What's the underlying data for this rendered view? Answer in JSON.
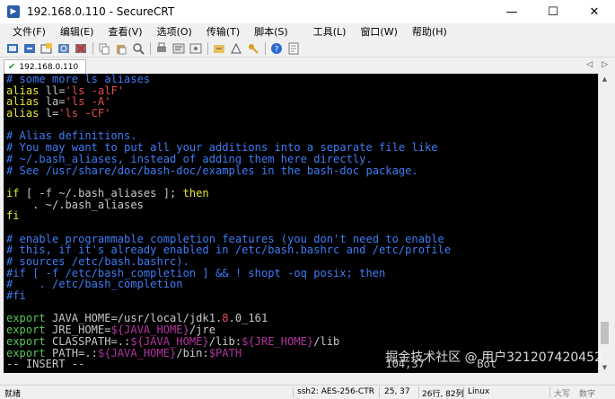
{
  "window": {
    "title": "192.168.0.110 - SecureCRT",
    "minimize": "—",
    "maximize": "☐",
    "close": "✕"
  },
  "menu": [
    "文件(F)",
    "编辑(E)",
    "查看(V)",
    "选项(O)",
    "传输(T)",
    "脚本(S)",
    "工具(L)",
    "窗口(W)",
    "帮助(H)"
  ],
  "tab": {
    "label": "192.168.0.110",
    "nav_prev": "◁",
    "nav_next": "▷"
  },
  "terminal": {
    "lines": [
      [
        {
          "c": "cmt",
          "t": "# some more ls aliases"
        }
      ],
      [
        {
          "c": "kw",
          "t": "alias "
        },
        {
          "c": "plain",
          "t": "ll="
        },
        {
          "c": "str",
          "t": "'ls -alF'"
        }
      ],
      [
        {
          "c": "kw",
          "t": "alias "
        },
        {
          "c": "plain",
          "t": "la="
        },
        {
          "c": "str",
          "t": "'ls -A'"
        }
      ],
      [
        {
          "c": "kw",
          "t": "alias "
        },
        {
          "c": "plain",
          "t": "l="
        },
        {
          "c": "str",
          "t": "'ls -CF'"
        }
      ],
      [
        {
          "c": "plain",
          "t": ""
        }
      ],
      [
        {
          "c": "cmt",
          "t": "# Alias definitions."
        }
      ],
      [
        {
          "c": "cmt",
          "t": "# You may want to put all your additions into a separate file like"
        }
      ],
      [
        {
          "c": "cmt",
          "t": "# ~/.bash_aliases, instead of adding them here directly."
        }
      ],
      [
        {
          "c": "cmt",
          "t": "# See /usr/share/doc/bash-doc/examples in the bash-doc package."
        }
      ],
      [
        {
          "c": "plain",
          "t": ""
        }
      ],
      [
        {
          "c": "kw",
          "t": "if "
        },
        {
          "c": "plain",
          "t": "[ -f ~/.bash_aliases ]; "
        },
        {
          "c": "kw",
          "t": "then"
        }
      ],
      [
        {
          "c": "plain",
          "t": "    . ~/.bash_aliases"
        }
      ],
      [
        {
          "c": "kw",
          "t": "fi"
        }
      ],
      [
        {
          "c": "plain",
          "t": ""
        }
      ],
      [
        {
          "c": "cmt",
          "t": "# enable programmable completion features (you don't need to enable"
        }
      ],
      [
        {
          "c": "cmt",
          "t": "# this, if it's already enabled in /etc/bash.bashrc and /etc/profile"
        }
      ],
      [
        {
          "c": "cmt",
          "t": "# sources /etc/bash.bashrc)."
        }
      ],
      [
        {
          "c": "cmt",
          "t": "#if [ -f /etc/bash_completion ] && ! shopt -oq posix; then"
        }
      ],
      [
        {
          "c": "cmt",
          "t": "#    . /etc/bash_completion"
        }
      ],
      [
        {
          "c": "cmt",
          "t": "#fi"
        }
      ],
      [
        {
          "c": "plain",
          "t": ""
        }
      ],
      [
        {
          "c": "grn",
          "t": "export "
        },
        {
          "c": "plain",
          "t": "JAVA_HOME=/usr/local/jdk1."
        },
        {
          "c": "num",
          "t": "8"
        },
        {
          "c": "plain",
          "t": ".0_161"
        }
      ],
      [
        {
          "c": "grn",
          "t": "export "
        },
        {
          "c": "plain",
          "t": "JRE_HOME="
        },
        {
          "c": "var",
          "t": "${JAVA_HOME}"
        },
        {
          "c": "plain",
          "t": "/jre"
        }
      ],
      [
        {
          "c": "grn",
          "t": "export "
        },
        {
          "c": "plain",
          "t": "CLASSPATH=.:"
        },
        {
          "c": "var",
          "t": "${JAVA_HOME}"
        },
        {
          "c": "plain",
          "t": "/lib:"
        },
        {
          "c": "var",
          "t": "${JRE_HOME}"
        },
        {
          "c": "plain",
          "t": "/lib"
        }
      ],
      [
        {
          "c": "grn",
          "t": "export "
        },
        {
          "c": "plain",
          "t": "PATH=.:"
        },
        {
          "c": "var",
          "t": "${JAVA_HOME}"
        },
        {
          "c": "plain",
          "t": "/bin:"
        },
        {
          "c": "var",
          "t": "$PATH"
        }
      ],
      [
        {
          "c": "plain",
          "t": "-- INSERT --                                              104,37        Bot"
        }
      ]
    ]
  },
  "watermark": "掘金技术社区 @ 用户3212074204​52",
  "status": {
    "ready": "就绪",
    "ssh": "ssh2: AES-256-CTR",
    "pos": "25,  37",
    "size": "26行, 82列",
    "os": "Linux",
    "caps": "大写",
    "num": "数字"
  },
  "scroll": {
    "position": 0.93,
    "visible": 0.08
  },
  "colors": {
    "terminal_bg": "#000000",
    "comment": "#3f7cf5",
    "keyword": "#e8e830",
    "string": "#e84d4d",
    "variable": "#b2329e",
    "export": "#55c755"
  }
}
